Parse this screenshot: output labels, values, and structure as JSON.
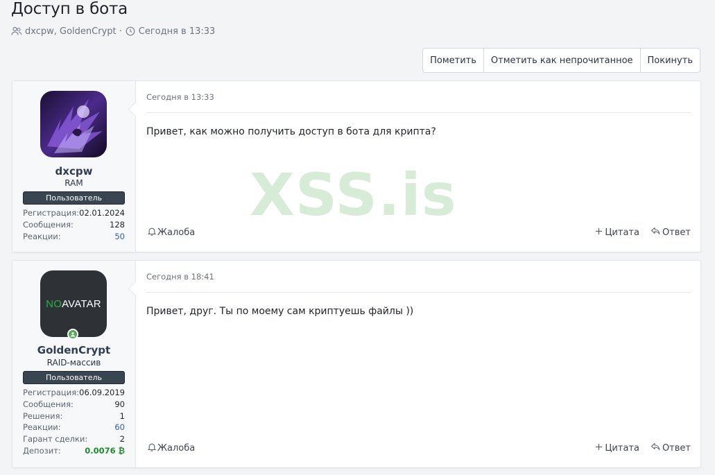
{
  "thread": {
    "title": "Доступ в бота",
    "participants": "dxcpw, GoldenCrypt",
    "separator": "·",
    "date": "Сегодня в 13:33"
  },
  "actions": {
    "mark": "Пометить",
    "mark_unread": "Отметить как непрочитанное",
    "leave": "Покинуть"
  },
  "watermark": "XSS.is",
  "posts": [
    {
      "username": "dxcpw",
      "user_title": "RAM",
      "banner": "Пользователь",
      "stats": [
        {
          "label": "Регистрация:",
          "value": "02.01.2024"
        },
        {
          "label": "Сообщения:",
          "value": "128"
        },
        {
          "label": "Реакции:",
          "value": "50"
        }
      ],
      "time": "Сегодня в 13:33",
      "text": "Привет, как можно получить доступ в бота для крипта?",
      "report": "Жалоба",
      "quote": "Цитата",
      "reply": "Ответ"
    },
    {
      "username": "GoldenCrypt",
      "user_title": "RAID-массив",
      "banner": "Пользователь",
      "avatar_text_no": "NO",
      "avatar_text_avatar": "AVATAR",
      "stats": [
        {
          "label": "Регистрация:",
          "value": "06.09.2019"
        },
        {
          "label": "Сообщения:",
          "value": "90"
        },
        {
          "label": "Решения:",
          "value": "1"
        },
        {
          "label": "Реакции:",
          "value": "60"
        },
        {
          "label": "Гарант сделки:",
          "value": "2"
        },
        {
          "label": "Депозит:",
          "value": "0.0076 ₿"
        }
      ],
      "time": "Сегодня в 18:41",
      "text": "Привет, друг. Ты по моему сам криптуешь файлы ))",
      "report": "Жалоба",
      "quote": "Цитата",
      "reply": "Ответ"
    }
  ],
  "colors": {
    "link": "#2d5ea8",
    "deposit": "#1e8c2b",
    "banner": "#3a4552",
    "online": "#4caf50",
    "watermark": "#c9e6c9"
  },
  "icons": {
    "participants": "users-icon",
    "date": "clock-icon",
    "report": "bell-icon",
    "quote": "plus-icon",
    "reply": "reply-icon",
    "online": "online-user-icon"
  }
}
